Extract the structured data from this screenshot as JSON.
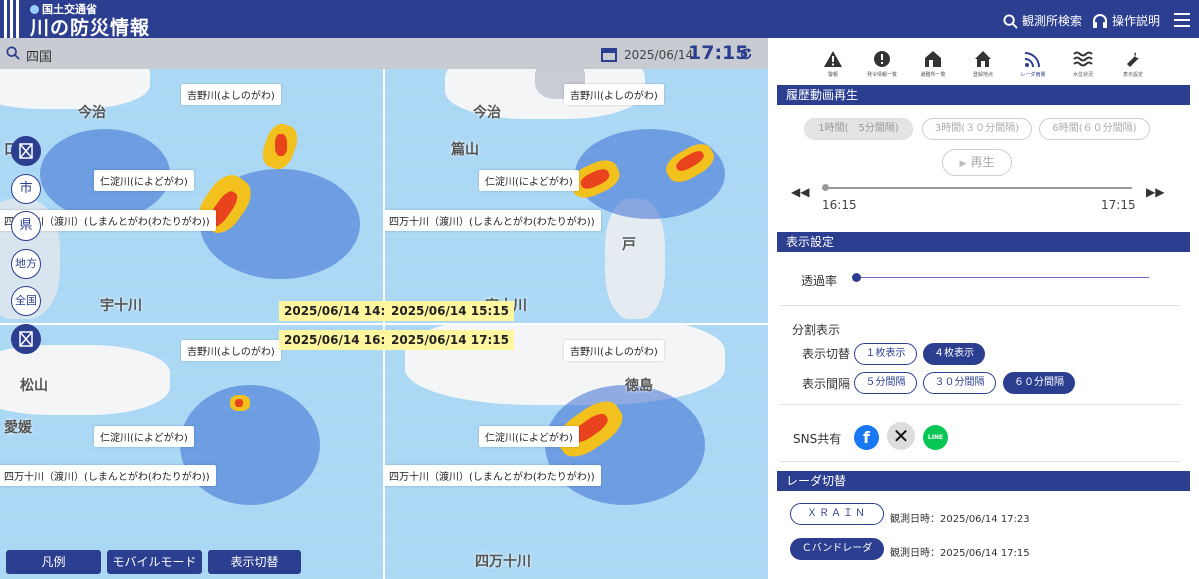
{
  "header": {
    "ministry": "国土交通省",
    "title": "川の防災情報",
    "search_label": "観測所検索",
    "help_label": "操作説明"
  },
  "mapbar": {
    "region": "四国",
    "date": "2025/06/14",
    "time": "17:15"
  },
  "quadrants": [
    {
      "river_labels": [
        "吉野川(よしのがわ)",
        "仁淀川(によどがわ)",
        "四万十川（渡川）(しまんとがわ(わたりがわ))"
      ],
      "cities": [
        "今治",
        "口橋",
        "宇十川"
      ],
      "time": "2025/06/14 14:15"
    },
    {
      "river_labels": [
        "吉野川(よしのがわ)",
        "仁淀川(によどがわ)",
        "四万十川（渡川）(しまんとがわ(わたりがわ))"
      ],
      "cities": [
        "今治",
        "篇山",
        "戸",
        "宇十川"
      ],
      "time": "2025/06/14 15:15"
    },
    {
      "river_labels": [
        "吉野川(よしのがわ)",
        "仁淀川(によどがわ)",
        "四万十川（渡川）(しまんとがわ(わたりがわ))"
      ],
      "cities": [
        "松山",
        "愛媛"
      ],
      "time": "2025/06/14 16:15"
    },
    {
      "river_labels": [
        "吉野川(よしのがわ)",
        "仁淀川(によどがわ)",
        "四万十川（渡川）(しまんとがわ(わたりがわ))"
      ],
      "cities": [
        "徳島",
        "四万十川"
      ],
      "time": "2025/06/14 17:15"
    }
  ],
  "side_buttons": [
    "市",
    "県",
    "地方",
    "全国"
  ],
  "bottom_buttons": [
    "凡例",
    "モバイルモード",
    "表示切替"
  ],
  "toolbar": [
    {
      "icon": "warning-icon",
      "label": "警報"
    },
    {
      "icon": "alert-circle-icon",
      "label": "発令情報一覧"
    },
    {
      "icon": "house-list-icon",
      "label": "避難所一覧"
    },
    {
      "icon": "home-icon",
      "label": "登録地点"
    },
    {
      "icon": "radar-icon",
      "label": "レーダ雨量"
    },
    {
      "icon": "water-level-icon",
      "label": "水位状況"
    },
    {
      "icon": "tool-icon",
      "label": "表示設定"
    }
  ],
  "history": {
    "title": "履歴動画再生",
    "btn_1h": "1時間(　5分間隔)",
    "btn_3h": "3時間(３０分間隔)",
    "btn_6h": "6時間(６０分間隔)",
    "play": "再生",
    "start": "16:15",
    "end": "17:15",
    "progress": 0.0
  },
  "display": {
    "title": "表示設定",
    "opacity_label": "透過率",
    "opacity": 0.0,
    "split_title": "分割表示",
    "switch_label": "表示切替",
    "one": "１枚表示",
    "four": "４枚表示",
    "interval_label": "表示間隔",
    "i5": "５分間隔",
    "i30": "３０分間隔",
    "i60": "６０分間隔",
    "sns_label": "SNS共有"
  },
  "radar": {
    "title": "レーダ切替",
    "xrain": "ＸＲＡＩＮ",
    "xrain_time": "観測日時：2025/06/14 17:23",
    "cband": "Ｃバンドレーダ",
    "cband_time": "観測日時：2025/06/14 17:15"
  },
  "colors": {
    "primary": "#2c3e8f",
    "heavy": "#e8431d",
    "mid": "#f3c11d",
    "timestamp_bg": "#fff7a0",
    "facebook": "#1877f2",
    "line": "#06c755"
  }
}
